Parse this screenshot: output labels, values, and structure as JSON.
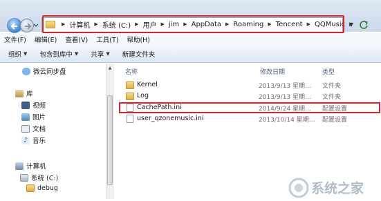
{
  "address_bar": {
    "crumbs": [
      "计算机",
      "系统 (C:)",
      "用户",
      "jim",
      "AppData",
      "Roaming",
      "Tencent",
      "QQMusic"
    ]
  },
  "menu": [
    "文件(F)",
    "编辑(E)",
    "查看(V)",
    "工具(T)",
    "帮助(H)"
  ],
  "commands": {
    "organize": "组织",
    "include_library": "包含到库中",
    "share": "共享",
    "new_folder": "新建文件夹"
  },
  "nav": {
    "weiyun": "微云同步盘",
    "library": "库",
    "videos": "视频",
    "pictures": "图片",
    "documents": "文档",
    "music": "音乐",
    "computer": "计算机",
    "system_c": "系统 (C:)",
    "debug": "debug"
  },
  "columns": {
    "name": "名称",
    "modified": "修改日期",
    "type": "类型"
  },
  "files": [
    {
      "name": "Kernel",
      "modified": "2013/9/13 星期...",
      "type": "文件夹",
      "icon": "folder-icon"
    },
    {
      "name": "Log",
      "modified": "2013/9/13 星期...",
      "type": "文件夹",
      "icon": "folder-icon"
    },
    {
      "name": "CachePath.ini",
      "modified": "2014/9/24 星期...",
      "type": "配置设置",
      "icon": "ini-file-icon"
    },
    {
      "name": "user_qzonemusic.ini",
      "modified": "2013/10/14 星期...",
      "type": "配置设置",
      "icon": "ini-file-icon"
    }
  ],
  "watermark": {
    "text": "系统之家"
  },
  "colors": {
    "highlight_border": "#d9242c",
    "header_text": "#4c607a"
  }
}
